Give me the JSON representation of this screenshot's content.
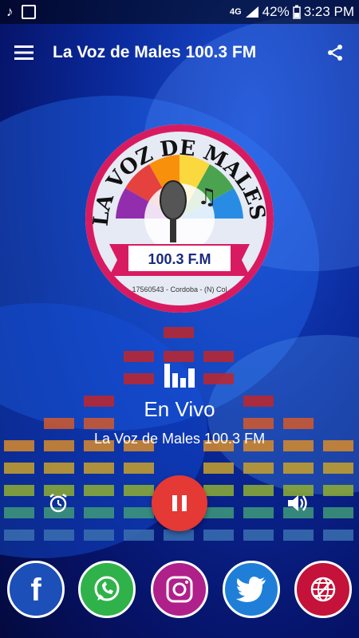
{
  "status_bar": {
    "battery": "42%",
    "time": "3:23 PM",
    "network": "4G"
  },
  "app_bar": {
    "title": "La Voz de Males 100.3 FM"
  },
  "logo": {
    "title_text": "LA VOZ DE MALES",
    "frequency": "100.3 F.M",
    "footer_text": "17560543 - Cordoba - (N) Col"
  },
  "player": {
    "status": "En Vivo",
    "station_name": "La Voz de Males 100.3 FM"
  },
  "social": [
    "facebook",
    "whatsapp",
    "instagram",
    "twitter",
    "web"
  ],
  "colors": {
    "accent": "#e53935",
    "primary_bg": "#0a2a9c"
  }
}
